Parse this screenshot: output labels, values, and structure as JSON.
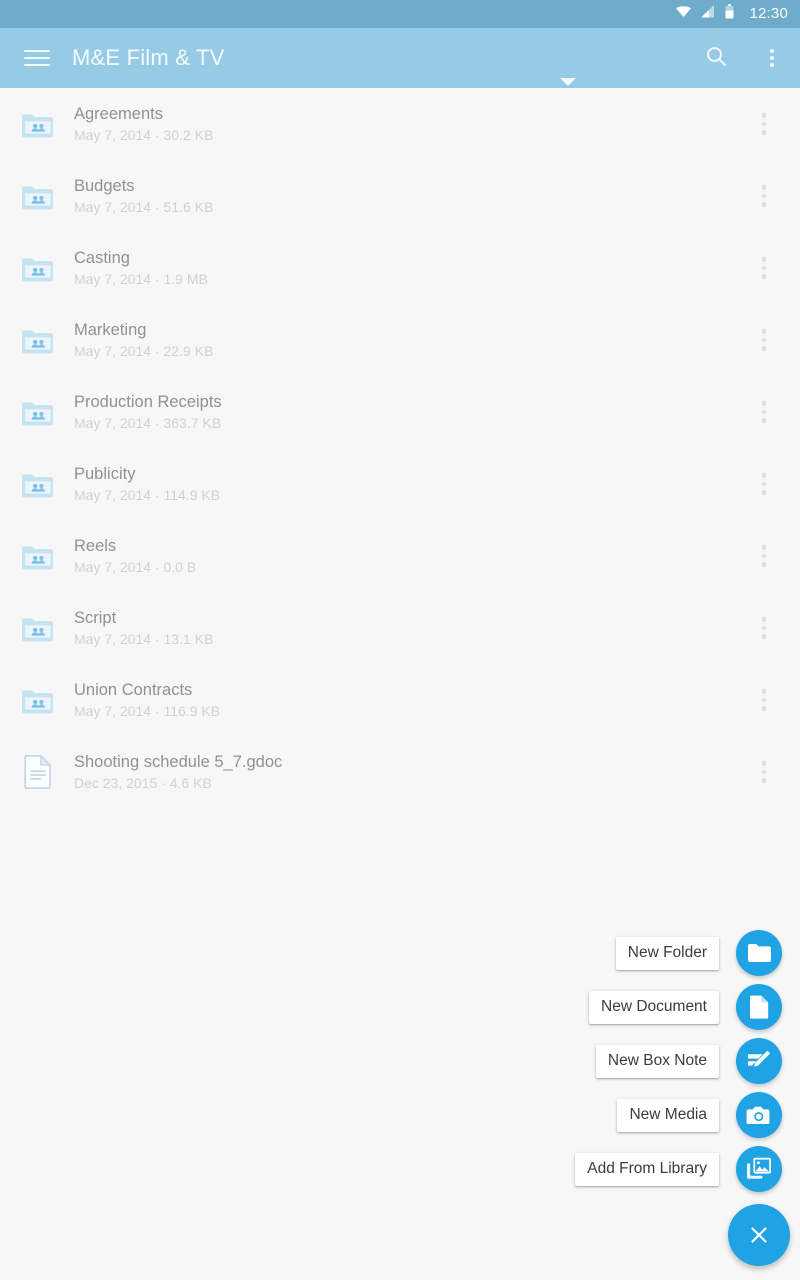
{
  "status_bar": {
    "time": "12:30",
    "icons": [
      "wifi-icon",
      "cellular-signal-icon",
      "battery-icon"
    ],
    "background_color": "#6fabcb"
  },
  "app_bar": {
    "menu_icon": "hamburger-menu-icon",
    "title": "M&E Film & TV",
    "dropdown_icon": "chevron-down-icon",
    "search_icon": "search-icon",
    "overflow_icon": "more-vertical-icon",
    "background_color": "#97cbe5",
    "text_color": "#f4fbfe"
  },
  "file_list": {
    "rows": [
      {
        "name": "Agreements",
        "date": "May 7, 2014",
        "size": "30.2 KB",
        "separator": "·",
        "icon": "shared-folder-icon",
        "type": "folder"
      },
      {
        "name": "Budgets",
        "date": "May 7, 2014",
        "size": "51.6 KB",
        "separator": "·",
        "icon": "shared-folder-icon",
        "type": "folder"
      },
      {
        "name": "Casting",
        "date": "May 7, 2014",
        "size": "1.9 MB",
        "separator": "·",
        "icon": "shared-folder-icon",
        "type": "folder"
      },
      {
        "name": "Marketing",
        "date": "May 7, 2014",
        "size": "22.9 KB",
        "separator": "·",
        "icon": "shared-folder-icon",
        "type": "folder"
      },
      {
        "name": "Production Receipts",
        "date": "May 7, 2014",
        "size": "363.7 KB",
        "separator": "·",
        "icon": "shared-folder-icon",
        "type": "folder"
      },
      {
        "name": "Publicity",
        "date": "May 7, 2014",
        "size": "114.9 KB",
        "separator": "·",
        "icon": "shared-folder-icon",
        "type": "folder"
      },
      {
        "name": "Reels",
        "date": "May 7, 2014",
        "size": "0.0 B",
        "separator": "·",
        "icon": "shared-folder-icon",
        "type": "folder"
      },
      {
        "name": "Script",
        "date": "May 7, 2014",
        "size": "13.1 KB",
        "separator": "·",
        "icon": "shared-folder-icon",
        "type": "folder"
      },
      {
        "name": "Union Contracts",
        "date": "May 7, 2014",
        "size": "116.9 KB",
        "separator": "·",
        "icon": "shared-folder-icon",
        "type": "folder"
      },
      {
        "name": "Shooting schedule 5_7.gdoc",
        "date": "Dec 23, 2015",
        "size": "4.6 KB",
        "separator": "·",
        "icon": "document-icon",
        "type": "file"
      }
    ],
    "row_overflow_icon": "more-vertical-icon",
    "name_color": "#8d9296",
    "meta_color": "#cfd2d4"
  },
  "fab_menu": {
    "expanded": true,
    "accent_color": "#1fa3e4",
    "items": [
      {
        "label": "New Folder",
        "icon": "folder-icon"
      },
      {
        "label": "New Document",
        "icon": "file-icon"
      },
      {
        "label": "New Box Note",
        "icon": "note-pencil-icon"
      },
      {
        "label": "New Media",
        "icon": "camera-icon"
      },
      {
        "label": "Add From Library",
        "icon": "photo-library-icon"
      }
    ],
    "close_label": "",
    "close_icon": "close-icon"
  }
}
